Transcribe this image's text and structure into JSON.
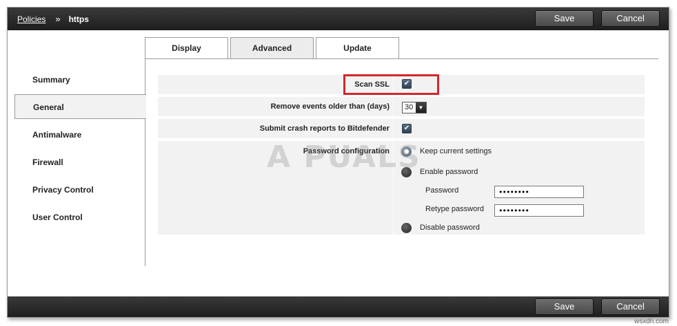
{
  "header": {
    "breadcrumb_root": "Policies",
    "breadcrumb_separator": "»",
    "breadcrumb_current": "https",
    "save_label": "Save",
    "cancel_label": "Cancel"
  },
  "footer": {
    "save_label": "Save",
    "cancel_label": "Cancel"
  },
  "sidebar": {
    "items": [
      {
        "label": "Summary"
      },
      {
        "label": "General"
      },
      {
        "label": "Antimalware"
      },
      {
        "label": "Firewall"
      },
      {
        "label": "Privacy Control"
      },
      {
        "label": "User Control"
      }
    ],
    "active": "General"
  },
  "tabs": [
    {
      "label": "Display"
    },
    {
      "label": "Advanced"
    },
    {
      "label": "Update"
    }
  ],
  "active_tab": "Advanced",
  "settings": {
    "scan_ssl": {
      "label": "Scan SSL",
      "checked": true
    },
    "remove_events": {
      "label": "Remove events older than (days)",
      "value": "30"
    },
    "crash_reports": {
      "label": "Submit crash reports to Bitdefender",
      "checked": true
    },
    "password_config": {
      "label": "Password configuration",
      "options": [
        {
          "label": "Keep current settings",
          "selected": true
        },
        {
          "label": "Enable password",
          "selected": false
        },
        {
          "label": "Disable password",
          "selected": false
        }
      ],
      "password_label": "Password",
      "password_value": "••••••••",
      "retype_label": "Retype password",
      "retype_value": "••••••••"
    }
  },
  "colors": {
    "highlight": "#d3262c",
    "bar": "#2a2a2a"
  },
  "icons": {
    "checkbox_mark": "✔",
    "select_arrow": "▼"
  },
  "watermark": {
    "logo": "A  PUALS",
    "site": "wsxdn.com"
  }
}
